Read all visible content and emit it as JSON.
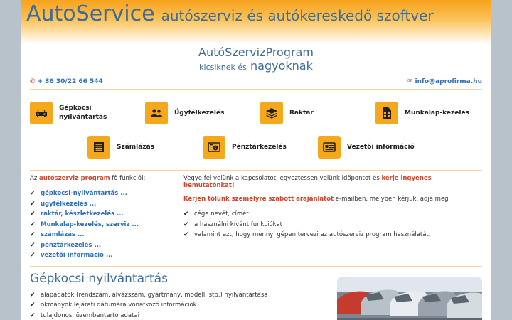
{
  "header": {
    "brand": "AutoService",
    "tagline": "autószerviz és autókereskedő szoftver"
  },
  "hero": {
    "title": "AutóSzervizProgram",
    "sub_small": "kicsiknek és",
    "sub_big": "nagyoknak"
  },
  "contact": {
    "phone": "+ 36 30/22 66 544",
    "email": "info@aprofirma.hu"
  },
  "tiles": [
    {
      "label": "Gépkocsi nyilvántartás",
      "icon": "car-icon"
    },
    {
      "label": "Ügyfélkezelés",
      "icon": "users-icon"
    },
    {
      "label": "Raktár",
      "icon": "layers-icon"
    },
    {
      "label": "Munkalap-kezelés",
      "icon": "document-icon"
    },
    {
      "label": "Számlázás",
      "icon": "invoice-icon"
    },
    {
      "label": "Pénztárkezelés",
      "icon": "cash-icon"
    },
    {
      "label": "Vezetői információ",
      "icon": "id-card-icon"
    }
  ],
  "functions": {
    "intro_prefix": "Az",
    "intro_highlight": "autószerviz-program",
    "intro_suffix": "fő funkciói:",
    "items": [
      "gépkocsi-nyilvántartás ...",
      "ügyfélkezelés ...",
      "raktár, készletkezelés ...",
      "Munkalap-kezelés, szerviz ...",
      "számlázás ...",
      "pénztárkezelés ...",
      "vezetői információ ..."
    ]
  },
  "offer": {
    "line1": "Vegye fel velünk a kapcsolatot, egyeztessen velünk időpontot és",
    "line1_highlight": "kérje ingyenes bemutatónkat!",
    "line2_highlight": "Kérjen tőlünk személyre szabott árajánlatot",
    "line2": "e-mailben, melyben kérjük, adja meg",
    "items": [
      "cége nevét, címét",
      "a használni kívánt funkciókat",
      "valamint azt, hogy mennyi gépen tervezi az autószerviz program használatát."
    ]
  },
  "section": {
    "title": "Gépkocsi nyilvántartás",
    "items": [
      "alapadatok (rendszám, alvázszám, gyártmány, modell, stb.) nyilvántartása",
      "okmányok lejárati dátumára vonatkozó információk",
      "tulajdonos, üzembentartó adatai"
    ]
  },
  "colors": {
    "accent": "#f6a81c",
    "title_blue": "#3d6c9a",
    "link_blue": "#2f6fb5",
    "highlight_red": "#d0452b"
  }
}
